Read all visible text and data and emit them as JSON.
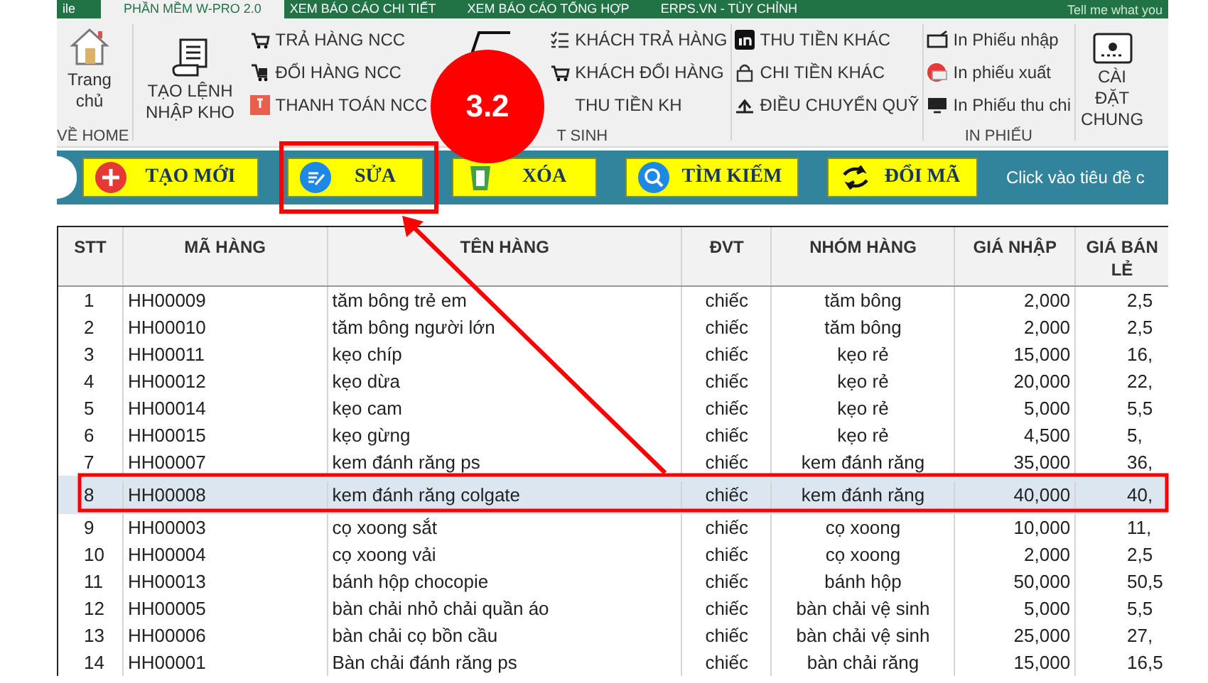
{
  "ribbon_tabs": [
    {
      "label": "ile",
      "selected": false
    },
    {
      "label": "PHẦN MỀM W-PRO 2.0",
      "selected": true
    },
    {
      "label": "XEM BÁO CÁO CHI TIẾT",
      "selected": false
    },
    {
      "label": "XEM BÁO CÁO TỔNG HỢP",
      "selected": false
    },
    {
      "label": "ERPS.VN - TÙY CHỈNH",
      "selected": false
    }
  ],
  "tell_me": "Tell me what you",
  "ribbon": {
    "home": {
      "button": "Trang chủ",
      "label": "VỀ HOME"
    },
    "stock": {
      "large": "TẠO LỆNH NHẬP KHO",
      "suppliers": [
        "TRẢ HÀNG NCC",
        "ĐỔI HÀNG NCC",
        "THANH TOÁN NCC"
      ],
      "customers": [
        "KHÁCH TRẢ HÀNG",
        "KHÁCH ĐỔI HÀNG",
        "THU TIỀN KH"
      ],
      "label": "T SINH"
    },
    "cash": [
      "THU TIỀN KHÁC",
      "CHI TIỀN KHÁC",
      "ĐIỀU CHUYỂN QUỸ"
    ],
    "print": {
      "items": [
        "In Phiếu nhập",
        "In phiếu xuất",
        "In Phiếu thu chi"
      ],
      "label": "IN PHIẾU"
    },
    "settings": "CÀI ĐẶT CHUNG"
  },
  "toolbar": {
    "buttons": [
      {
        "kind": "add",
        "label": "TẠO MỚI"
      },
      {
        "kind": "edit",
        "label": "SỬA"
      },
      {
        "kind": "delete",
        "label": "XÓA"
      },
      {
        "kind": "search",
        "label": "TÌM KIẾM"
      },
      {
        "kind": "swap",
        "label": "ĐỔI MÃ"
      }
    ],
    "hint": "Click vào tiêu đề c"
  },
  "annotation": {
    "badge": "3.2"
  },
  "table": {
    "columns": [
      "STT",
      "MÃ HÀNG",
      "TÊN HÀNG",
      "ĐVT",
      "NHÓM HÀNG",
      "GIÁ NHẬP",
      "GIÁ BÁN LẺ"
    ],
    "rows": [
      {
        "cells": [
          "1",
          "HH00009",
          "tăm bông trẻ em",
          "chiếc",
          "tăm bông",
          "2,000",
          "2,5"
        ],
        "selected": false
      },
      {
        "cells": [
          "2",
          "HH00010",
          "tăm bông người lớn",
          "chiếc",
          "tăm bông",
          "2,000",
          "2,5"
        ],
        "selected": false
      },
      {
        "cells": [
          "3",
          "HH00011",
          "kẹo chíp",
          "chiếc",
          "kẹo rẻ",
          "15,000",
          "16,"
        ],
        "selected": false
      },
      {
        "cells": [
          "4",
          "HH00012",
          "kẹo dừa",
          "chiếc",
          "kẹo rẻ",
          "20,000",
          "22,"
        ],
        "selected": false
      },
      {
        "cells": [
          "5",
          "HH00014",
          "kẹo cam",
          "chiếc",
          "kẹo rẻ",
          "5,000",
          "5,5"
        ],
        "selected": false
      },
      {
        "cells": [
          "6",
          "HH00015",
          "kẹo gừng",
          "chiếc",
          "kẹo rẻ",
          "4,500",
          "5,"
        ],
        "selected": false
      },
      {
        "cells": [
          "7",
          "HH00007",
          "kem đánh răng ps",
          "chiếc",
          "kem đánh răng",
          "35,000",
          "36,"
        ],
        "selected": false
      },
      {
        "cells": [
          "8",
          "HH00008",
          "kem đánh răng colgate",
          "chiếc",
          "kem đánh răng",
          "40,000",
          "40,"
        ],
        "selected": true
      },
      {
        "cells": [
          "9",
          "HH00003",
          "cọ xoong sắt",
          "chiếc",
          "cọ xoong",
          "10,000",
          "11,"
        ],
        "selected": false
      },
      {
        "cells": [
          "10",
          "HH00004",
          "cọ xoong vải",
          "chiếc",
          "cọ xoong",
          "2,000",
          "2,5"
        ],
        "selected": false
      },
      {
        "cells": [
          "11",
          "HH00013",
          "bánh hộp chocopie",
          "chiếc",
          "bánh hộp",
          "50,000",
          "50,5"
        ],
        "selected": false
      },
      {
        "cells": [
          "12",
          "HH00005",
          "bàn chải nhỏ chải quần áo",
          "chiếc",
          "bàn chải vệ sinh",
          "5,000",
          "5,5"
        ],
        "selected": false
      },
      {
        "cells": [
          "13",
          "HH00006",
          "bàn chải cọ bồn cầu",
          "chiếc",
          "bàn chải vệ sinh",
          "25,000",
          "27,"
        ],
        "selected": false
      },
      {
        "cells": [
          "14",
          "HH00001",
          "Bàn chải đánh răng ps",
          "chiếc",
          "bàn chải răng",
          "15,000",
          "16,5"
        ],
        "selected": false
      }
    ]
  }
}
